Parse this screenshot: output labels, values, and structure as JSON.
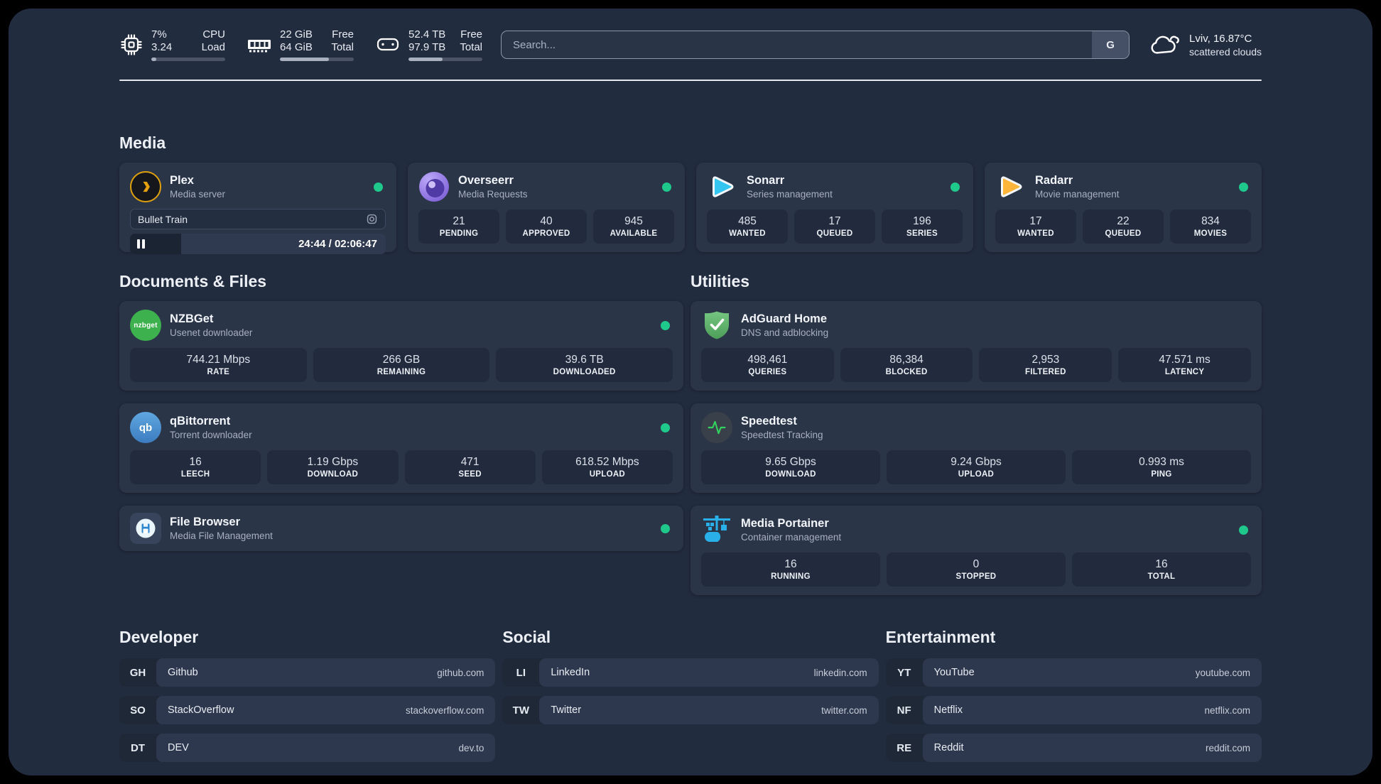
{
  "header": {
    "cpu": {
      "line1": "7%",
      "line2": "3.24",
      "label1": "CPU",
      "label2": "Load",
      "progress_pct": 7
    },
    "ram": {
      "line1": "22 GiB",
      "line2": "64 GiB",
      "label1": "Free",
      "label2": "Total",
      "progress_pct": 66
    },
    "disk": {
      "line1": "52.4 TB",
      "line2": "97.9 TB",
      "label1": "Free",
      "label2": "Total",
      "progress_pct": 46
    },
    "search": {
      "placeholder": "Search...",
      "engine": "G"
    },
    "weather": {
      "location": "Lviv, 16.87°C",
      "condition": "scattered clouds"
    }
  },
  "sections": {
    "media": "Media",
    "documents": "Documents & Files",
    "utilities": "Utilities",
    "developer": "Developer",
    "social": "Social",
    "entertainment": "Entertainment"
  },
  "apps": {
    "plex": {
      "name": "Plex",
      "desc": "Media server",
      "now_playing": "Bullet Train",
      "time": "24:44 / 02:06:47",
      "progress_pct": 20
    },
    "overseerr": {
      "name": "Overseerr",
      "desc": "Media Requests",
      "stats": [
        {
          "v": "21",
          "l": "PENDING"
        },
        {
          "v": "40",
          "l": "APPROVED"
        },
        {
          "v": "945",
          "l": "AVAILABLE"
        }
      ]
    },
    "sonarr": {
      "name": "Sonarr",
      "desc": "Series management",
      "stats": [
        {
          "v": "485",
          "l": "WANTED"
        },
        {
          "v": "17",
          "l": "QUEUED"
        },
        {
          "v": "196",
          "l": "SERIES"
        }
      ]
    },
    "radarr": {
      "name": "Radarr",
      "desc": "Movie management",
      "stats": [
        {
          "v": "17",
          "l": "WANTED"
        },
        {
          "v": "22",
          "l": "QUEUED"
        },
        {
          "v": "834",
          "l": "MOVIES"
        }
      ]
    },
    "nzbget": {
      "name": "NZBGet",
      "desc": "Usenet downloader",
      "icon_text": "nzbget",
      "stats": [
        {
          "v": "744.21 Mbps",
          "l": "RATE"
        },
        {
          "v": "266 GB",
          "l": "REMAINING"
        },
        {
          "v": "39.6 TB",
          "l": "DOWNLOADED"
        }
      ]
    },
    "qbittorrent": {
      "name": "qBittorrent",
      "desc": "Torrent downloader",
      "icon_text": "qb",
      "stats": [
        {
          "v": "16",
          "l": "LEECH"
        },
        {
          "v": "1.19 Gbps",
          "l": "DOWNLOAD"
        },
        {
          "v": "471",
          "l": "SEED"
        },
        {
          "v": "618.52 Mbps",
          "l": "UPLOAD"
        }
      ]
    },
    "filebrowser": {
      "name": "File Browser",
      "desc": "Media File Management"
    },
    "adguard": {
      "name": "AdGuard Home",
      "desc": "DNS and adblocking",
      "stats": [
        {
          "v": "498,461",
          "l": "QUERIES"
        },
        {
          "v": "86,384",
          "l": "BLOCKED"
        },
        {
          "v": "2,953",
          "l": "FILTERED"
        },
        {
          "v": "47.571 ms",
          "l": "LATENCY"
        }
      ]
    },
    "speedtest": {
      "name": "Speedtest",
      "desc": "Speedtest Tracking",
      "stats": [
        {
          "v": "9.65 Gbps",
          "l": "DOWNLOAD"
        },
        {
          "v": "9.24 Gbps",
          "l": "UPLOAD"
        },
        {
          "v": "0.993 ms",
          "l": "PING"
        }
      ]
    },
    "portainer": {
      "name": "Media Portainer",
      "desc": "Container management",
      "stats": [
        {
          "v": "16",
          "l": "RUNNING"
        },
        {
          "v": "0",
          "l": "STOPPED"
        },
        {
          "v": "16",
          "l": "TOTAL"
        }
      ]
    }
  },
  "bookmarks": {
    "developer": [
      {
        "abbr": "GH",
        "name": "Github",
        "url": "github.com"
      },
      {
        "abbr": "SO",
        "name": "StackOverflow",
        "url": "stackoverflow.com"
      },
      {
        "abbr": "DT",
        "name": "DEV",
        "url": "dev.to"
      }
    ],
    "social": [
      {
        "abbr": "LI",
        "name": "LinkedIn",
        "url": "linkedin.com"
      },
      {
        "abbr": "TW",
        "name": "Twitter",
        "url": "twitter.com"
      }
    ],
    "entertainment": [
      {
        "abbr": "YT",
        "name": "YouTube",
        "url": "youtube.com"
      },
      {
        "abbr": "NF",
        "name": "Netflix",
        "url": "netflix.com"
      },
      {
        "abbr": "RE",
        "name": "Reddit",
        "url": "reddit.com"
      }
    ]
  },
  "colors": {
    "status_green": "#1fc98c",
    "plex_amber": "#e5a00d",
    "sonarr_blue": "#35c5f1",
    "radarr_yellow": "#ffb53a",
    "nzbget_green": "#3db14d",
    "qbittorrent_blue": "#4a90d0",
    "adguard_green": "#5fb36b",
    "speedtest_green": "#33d15f",
    "portainer_blue": "#29b0e8"
  }
}
